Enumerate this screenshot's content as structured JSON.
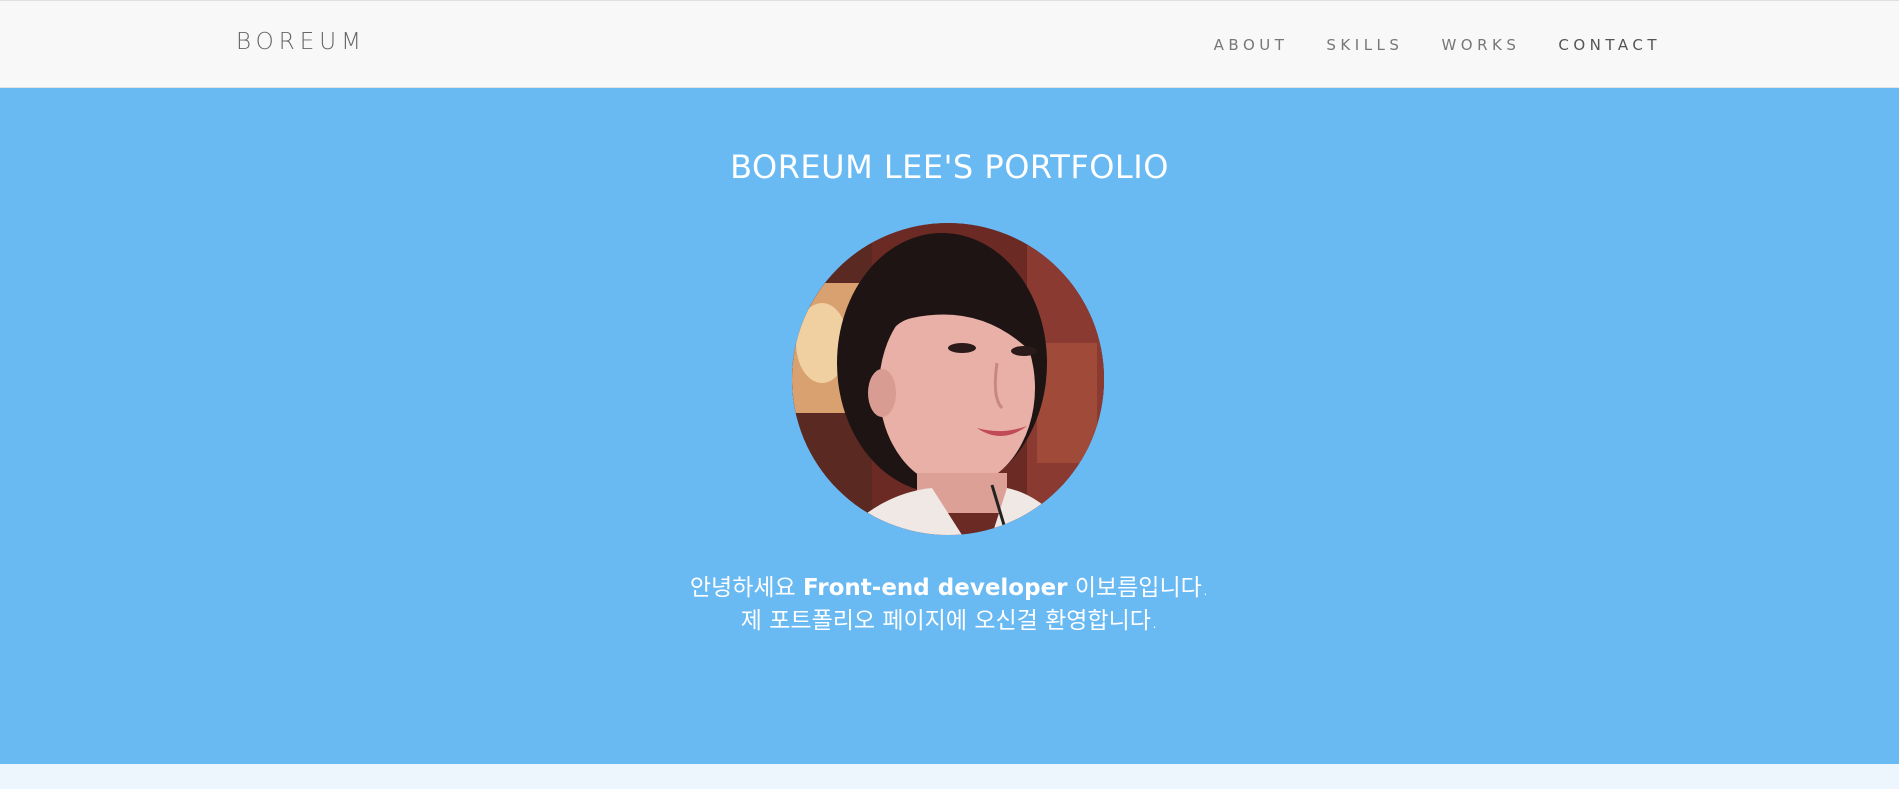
{
  "brand": "BOREUM",
  "nav": {
    "items": [
      "ABOUT",
      "SKILLS",
      "WORKS",
      "CONTACT"
    ]
  },
  "hero": {
    "title": "BOREUM LEE'S PORTFOLIO",
    "intro_line1_prefix": "안녕하세요",
    "intro_line1_bold": "Front-end developer",
    "intro_line1_suffix": "이보름입니다.",
    "intro_line2": "제 포트폴리오 페이지에 오신걸 환영합니다."
  },
  "colors": {
    "hero_bg": "#69b9f3",
    "navbar_bg": "#f8f8f8",
    "text_on_hero": "#ffffff"
  }
}
